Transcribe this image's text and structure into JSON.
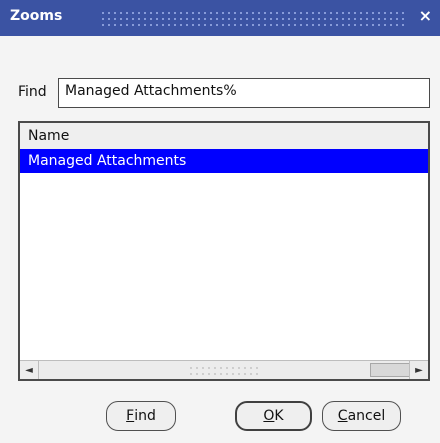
{
  "window": {
    "title": "Zooms",
    "close_glyph": "×"
  },
  "find": {
    "label": "Find",
    "value": "Managed Attachments%"
  },
  "list": {
    "column_header": "Name",
    "rows": [
      "Managed Attachments"
    ],
    "selected_index": 0
  },
  "scrollbar": {
    "left_arrow": "◄",
    "right_arrow": "►"
  },
  "buttons": {
    "find": {
      "mnemonic": "F",
      "rest": "ind"
    },
    "ok": {
      "mnemonic": "O",
      "rest": "K"
    },
    "cancel": {
      "mnemonic": "C",
      "rest": "ancel"
    }
  },
  "colors": {
    "titlebar": "#3b53a3",
    "selection": "#0000ff",
    "dialog_bg": "#f4f4f4"
  }
}
